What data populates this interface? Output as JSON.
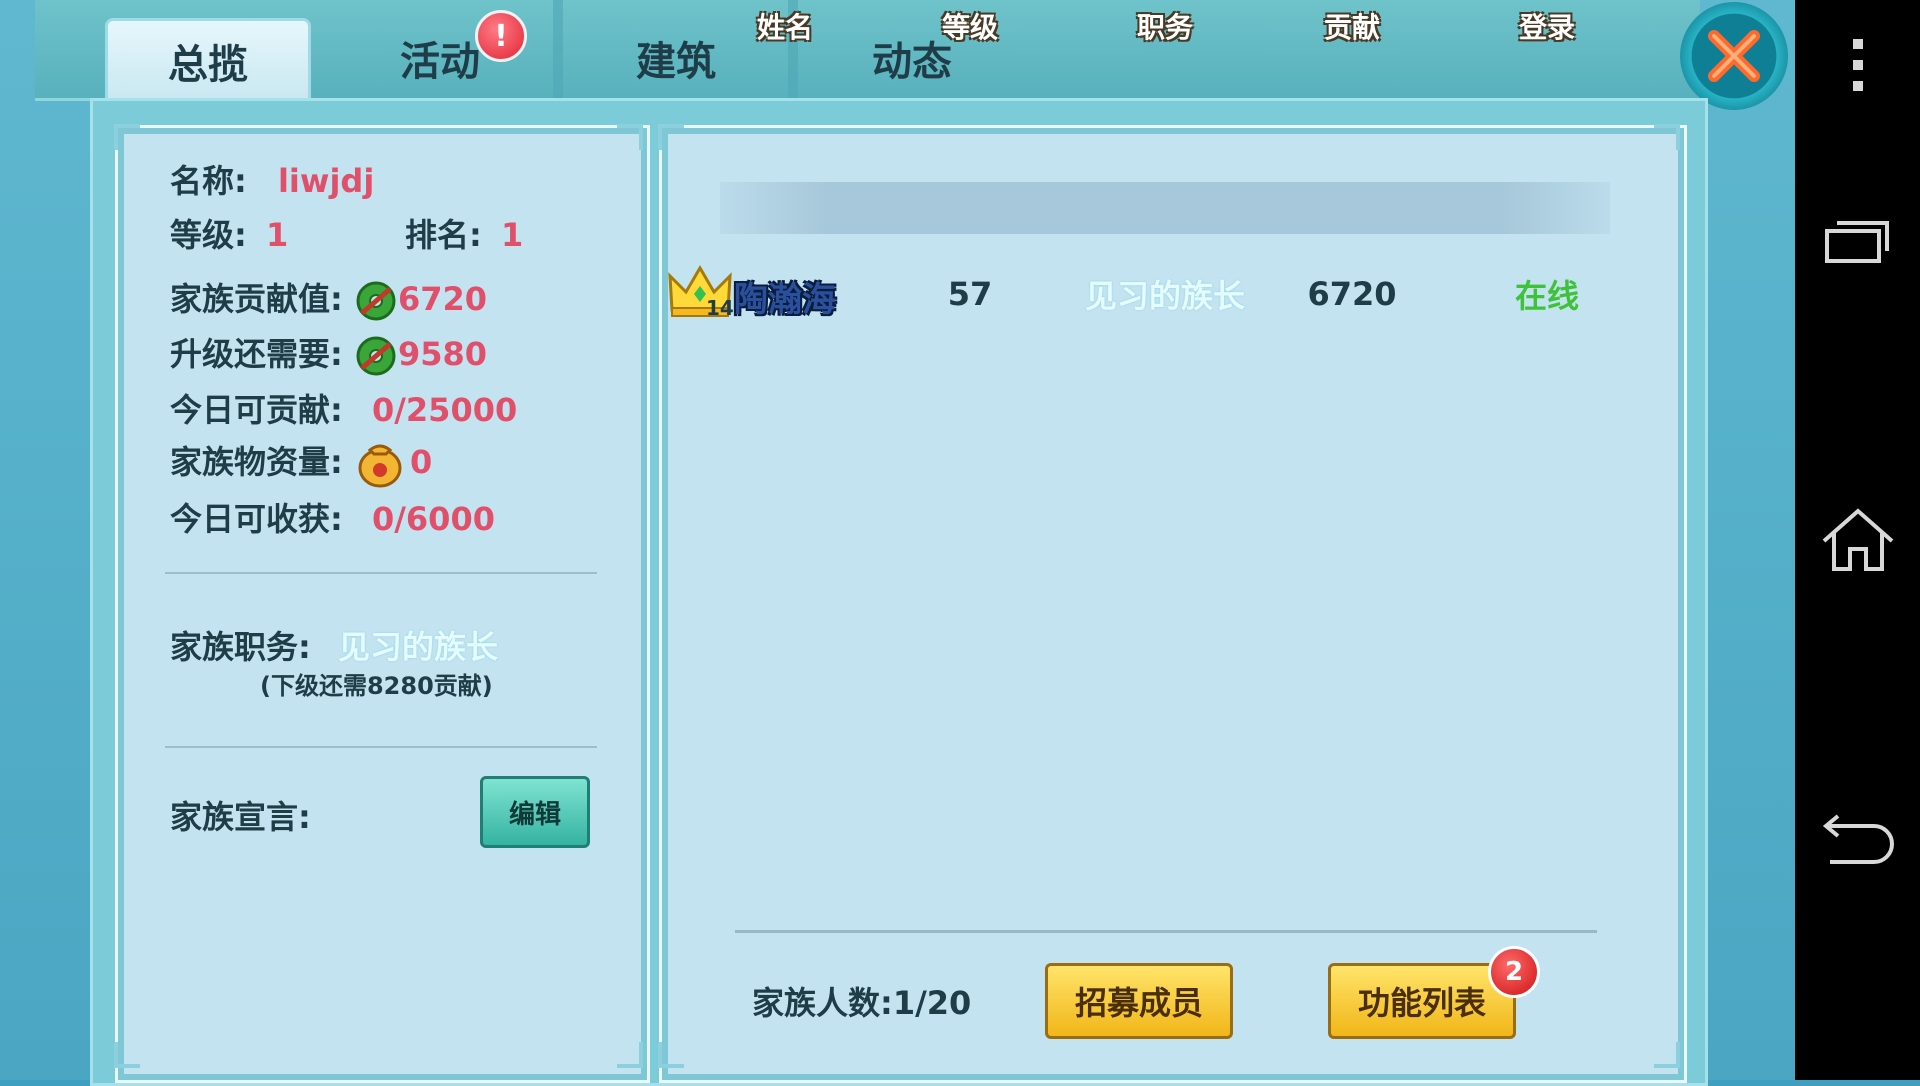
{
  "tabs": [
    {
      "label": "总揽",
      "active": true
    },
    {
      "label": "活动",
      "active": false,
      "badge": "!"
    },
    {
      "label": "建筑",
      "active": false
    },
    {
      "label": "动态",
      "active": false
    }
  ],
  "overview": {
    "name_label": "名称:",
    "name_value": "liwjdj",
    "level_label": "等级:",
    "level_value": "1",
    "rank_label": "排名:",
    "rank_value": "1",
    "contribution_label": "家族贡献值:",
    "contribution_value": "6720",
    "upgrade_label": "升级还需要:",
    "upgrade_value": "9580",
    "daily_contrib_label": "今日可贡献:",
    "daily_contrib_value": "0/25000",
    "supplies_label": "家族物资量:",
    "supplies_value": "0",
    "daily_harvest_label": "今日可收获:",
    "daily_harvest_value": "0/6000",
    "position_label": "家族职务:",
    "position_value": "见习的族长",
    "next_level_note": "(下级还需8280贡献)",
    "declaration_label": "家族宣言:",
    "edit_button": "编辑"
  },
  "members_table": {
    "headers": [
      "姓名",
      "等级",
      "职务",
      "贡献",
      "登录"
    ],
    "rows": [
      {
        "crown_level": "14",
        "name": "陶瀚海",
        "level": "57",
        "role": "见习的族长",
        "contribution": "6720",
        "login": "在线"
      }
    ]
  },
  "footer": {
    "member_count_label": "家族人数:",
    "member_count_value": "1/20",
    "recruit_button": "招募成员",
    "function_list_button": "功能列表",
    "function_list_badge": "2"
  },
  "colors": {
    "accent_red": "#e0506a",
    "online_green": "#3fc23a",
    "role_cyan": "#e6fbff",
    "button_yellow": "#f1b619"
  }
}
